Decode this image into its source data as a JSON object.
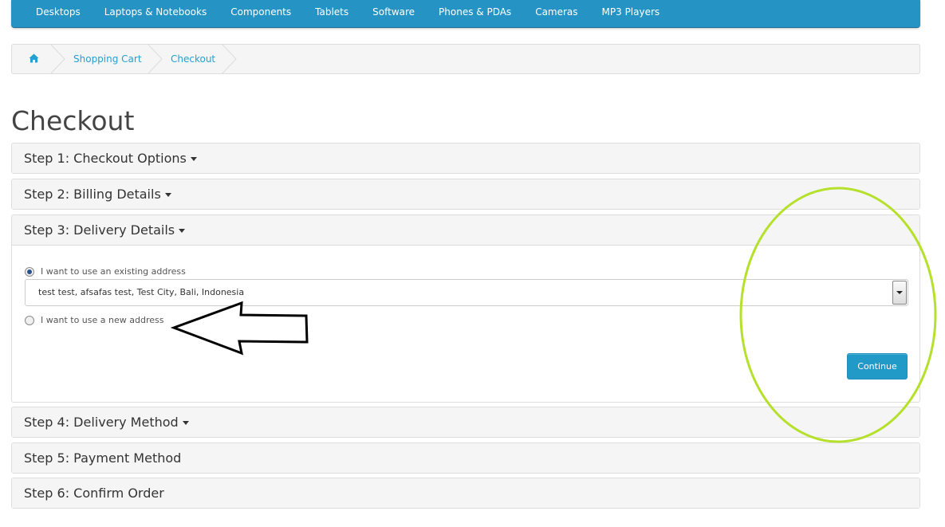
{
  "menu": {
    "items": [
      "Desktops",
      "Laptops & Notebooks",
      "Components",
      "Tablets",
      "Software",
      "Phones & PDAs",
      "Cameras",
      "MP3 Players"
    ]
  },
  "breadcrumb": {
    "home_icon": "home-icon",
    "items": [
      "Shopping Cart",
      "Checkout"
    ]
  },
  "page": {
    "title": "Checkout"
  },
  "steps": [
    "Step 1: Checkout Options",
    "Step 2: Billing Details",
    "Step 3: Delivery Details",
    "Step 4: Delivery Method",
    "Step 5: Payment Method",
    "Step 6: Confirm Order"
  ],
  "delivery": {
    "existing_label": "I want to use an existing address",
    "existing_selected": true,
    "address_value": "test test, afsafas test, Test City, Bali, Indonesia",
    "new_label": "I want to use a new address",
    "continue_label": "Continue"
  },
  "colors": {
    "menu_bar": "#2593c3",
    "link": "#23a1d1",
    "primary_button": "#229ac8",
    "annotation_ellipse": "#b5e02b",
    "annotation_arrow": "#000000"
  }
}
